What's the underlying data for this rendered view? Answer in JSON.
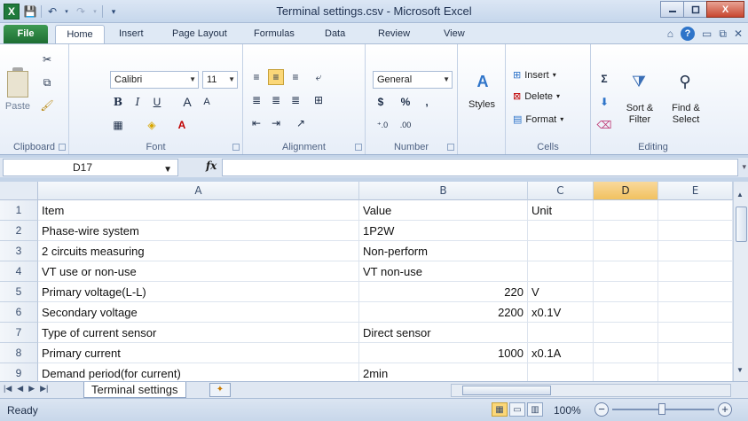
{
  "window": {
    "title": "Terminal settings.csv - Microsoft Excel",
    "minimize_label": "▭",
    "maximize_label": "⧉",
    "close_label": "X"
  },
  "ribbon_tabs": [
    "File",
    "Home",
    "Insert",
    "Page Layout",
    "Formulas",
    "Data",
    "Review",
    "View"
  ],
  "ribbon": {
    "clipboard": {
      "label": "Clipboard",
      "paste": "Paste"
    },
    "font": {
      "label": "Font",
      "name": "Calibri",
      "size": "11"
    },
    "alignment": {
      "label": "Alignment"
    },
    "number": {
      "label": "Number",
      "format": "General",
      "currency": "$",
      "percent": "%",
      "comma": ",",
      "inc_dec": "←.0 .00",
      "dec_dec": ".00 →.0"
    },
    "styles": {
      "label": "Styles"
    },
    "cells": {
      "label": "Cells",
      "insert": "Insert",
      "delete": "Delete",
      "format": "Format"
    },
    "editing": {
      "label": "Editing",
      "sort_filter": "Sort &",
      "sort_filter2": "Filter",
      "find_select": "Find &",
      "find_select2": "Select"
    }
  },
  "formula_bar": {
    "name_box": "D17",
    "fx": "fx",
    "formula": ""
  },
  "columns": [
    "A",
    "B",
    "C",
    "D",
    "E"
  ],
  "selected_column": "D",
  "rows": [
    {
      "num": "1",
      "a": "Item",
      "b": "Value",
      "b_num": false,
      "c": "Unit"
    },
    {
      "num": "2",
      "a": "Phase-wire system",
      "b": "1P2W",
      "b_num": false,
      "c": ""
    },
    {
      "num": "3",
      "a": "2 circuits measuring",
      "b": "Non-perform",
      "b_num": false,
      "c": ""
    },
    {
      "num": "4",
      "a": "VT use or non-use",
      "b": "VT non-use",
      "b_num": false,
      "c": ""
    },
    {
      "num": "5",
      "a": "Primary voltage(L-L)",
      "b": "220",
      "b_num": true,
      "c": "V"
    },
    {
      "num": "6",
      "a": "Secondary voltage",
      "b": "2200",
      "b_num": true,
      "c": "x0.1V"
    },
    {
      "num": "7",
      "a": "Type of current sensor",
      "b": "Direct sensor",
      "b_num": false,
      "c": ""
    },
    {
      "num": "8",
      "a": "Primary current",
      "b": "1000",
      "b_num": true,
      "c": "x0.1A"
    },
    {
      "num": "9",
      "a": "Demand period(for current)",
      "b": "2min",
      "b_num": false,
      "c": ""
    }
  ],
  "sheet_tabs": [
    "Terminal settings"
  ],
  "status": {
    "ready": "Ready",
    "zoom": "100%",
    "zoom_minus": "−",
    "zoom_plus": "+"
  }
}
